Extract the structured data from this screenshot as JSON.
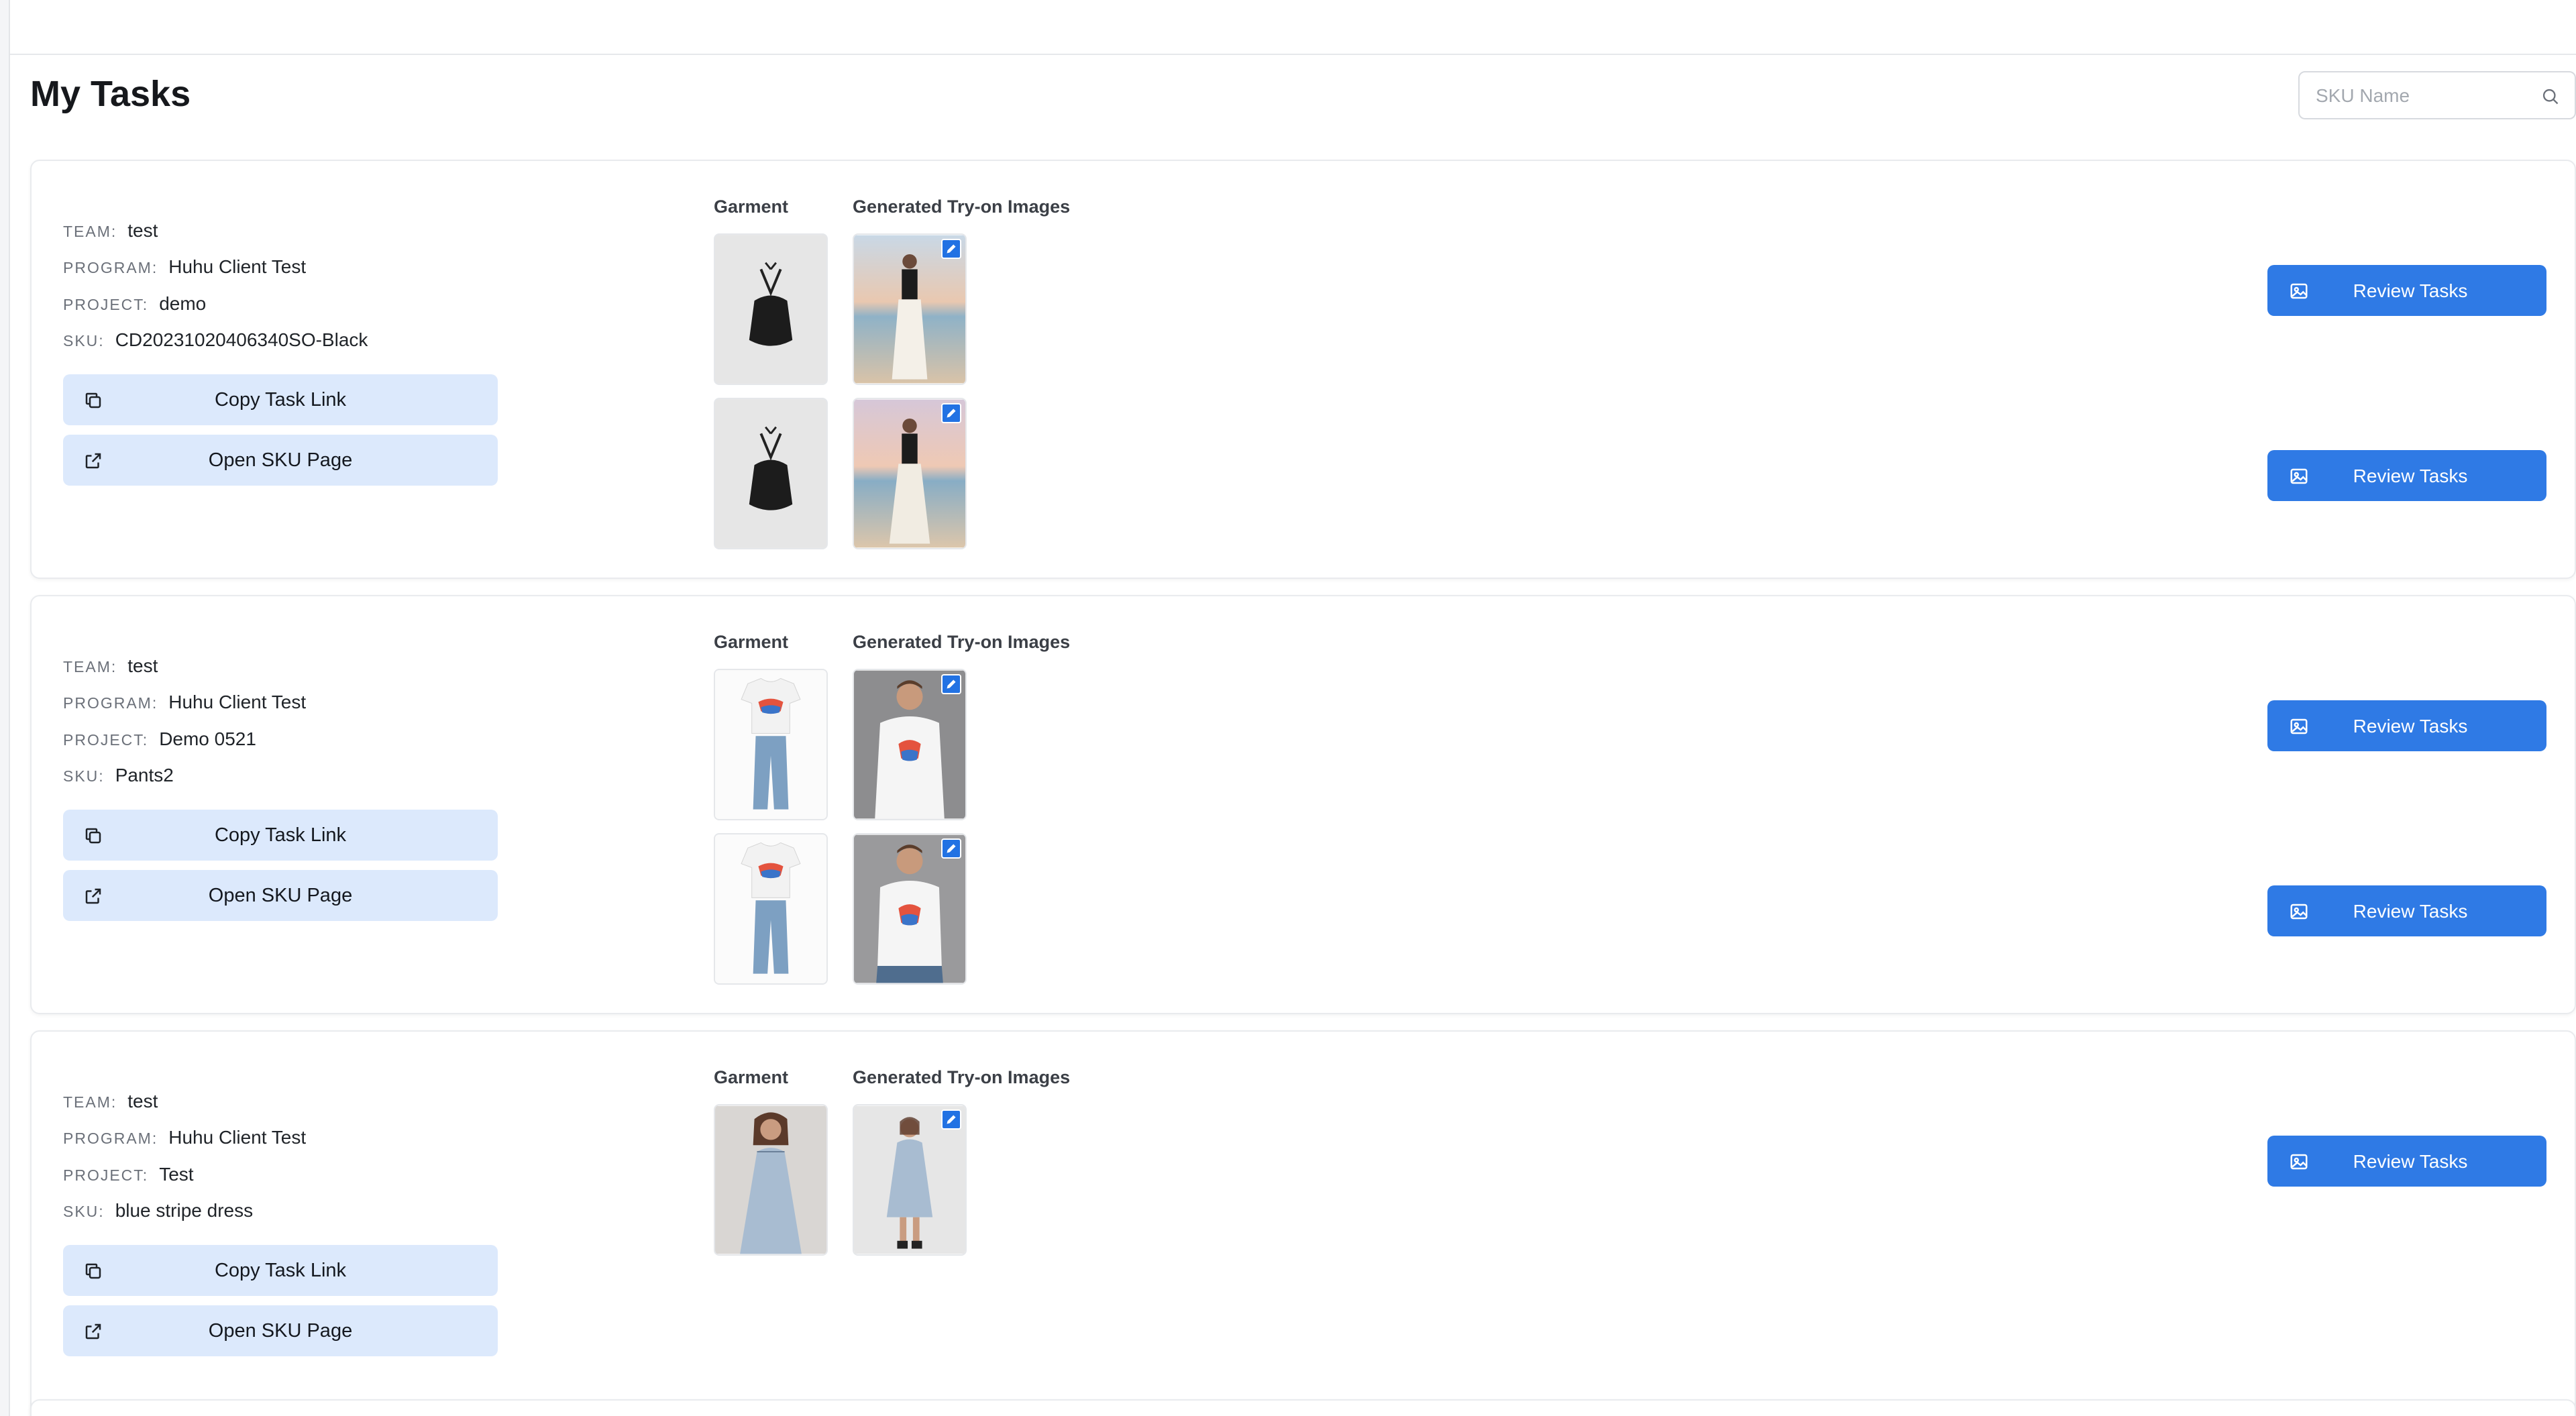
{
  "page": {
    "title": "My Tasks"
  },
  "search": {
    "placeholder": "SKU Name",
    "value": ""
  },
  "meta_keys": {
    "team": "TEAM:",
    "program": "PROGRAM:",
    "project": "PROJECT:",
    "sku": "SKU:"
  },
  "columns": {
    "garment": "Garment",
    "generated": "Generated Try-on Images"
  },
  "actions": {
    "copy_link": "Copy Task Link",
    "open_sku": "Open SKU Page",
    "review": "Review Tasks"
  },
  "tasks": [
    {
      "team": "test",
      "program": "Huhu Client Test",
      "project": "demo",
      "sku": "CD20231020406340SO-Black",
      "image_pairs": 2,
      "garment_icon": "halter-top-image",
      "tryon_icon": "beach-model-image"
    },
    {
      "team": "test",
      "program": "Huhu Client Test",
      "project": "Demo 0521",
      "sku": "Pants2",
      "image_pairs": 2,
      "garment_icon": "tshirt-jeans-image",
      "tryon_icon": "male-model-tshirt-image"
    },
    {
      "team": "test",
      "program": "Huhu Client Test",
      "project": "Test",
      "sku": "blue stripe dress",
      "image_pairs": 1,
      "garment_icon": "dress-model-image",
      "tryon_icon": "dress-tryon-image"
    }
  ],
  "colors": {
    "primary": "#2f7ae5",
    "secondary_button": "#dce9fc",
    "edit_badge": "#2272e3"
  }
}
